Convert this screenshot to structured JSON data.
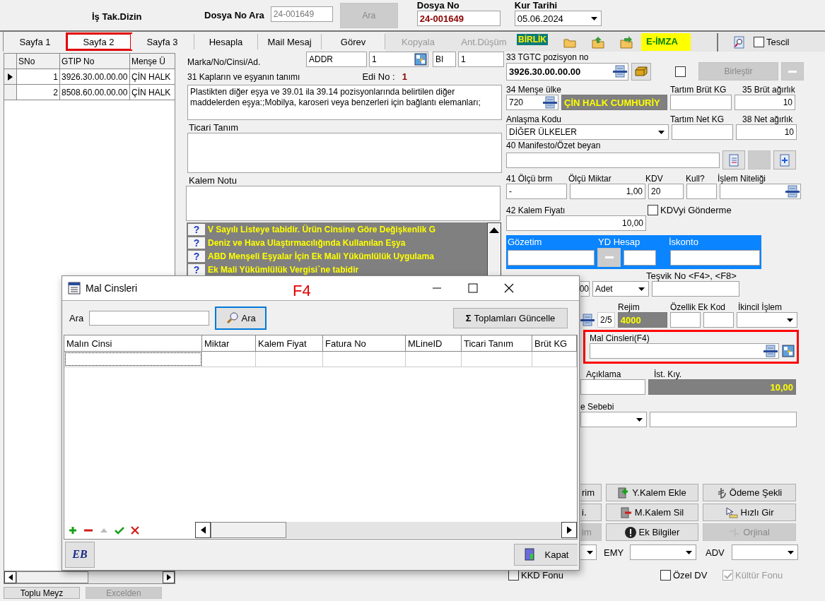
{
  "header": {
    "title": "İş Tak.Dizin",
    "search_label": "Dosya No Ara",
    "search_value": "24-001649",
    "search_button": {
      "label": "Ara",
      "disabled": true
    },
    "file_no_label": "Dosya No",
    "file_no": "24-001649",
    "rate_date_label": "Kur Tarihi",
    "rate_date": "05.06.2024"
  },
  "tabs": [
    {
      "label": "Sayfa 1",
      "selected": false,
      "highlighted": false
    },
    {
      "label": "Sayfa 2",
      "selected": true,
      "highlighted": true
    },
    {
      "label": "Sayfa 3",
      "selected": false,
      "highlighted": false
    },
    {
      "label": "Hesapla",
      "selected": false,
      "highlighted": false
    },
    {
      "label": "Mail Mesaj",
      "selected": false,
      "highlighted": false
    },
    {
      "label": "Görev",
      "selected": false,
      "highlighted": false
    }
  ],
  "toolbar": {
    "actions": [
      {
        "label": "Kopyala",
        "disabled": true
      },
      {
        "label": "Ant.Düşüm",
        "disabled": true
      }
    ],
    "birlik": "BİRLİK",
    "e_imza": "E-İMZA",
    "tescil": {
      "label": "Tescil",
      "checked": false
    }
  },
  "items_grid": {
    "columns": [
      "SNo",
      "GTIP No",
      "Menşe Ü"
    ],
    "rows": [
      {
        "sno": "1",
        "gtip": "3926.30.00.00.00",
        "origin": "ÇİN HALK",
        "selected": true
      },
      {
        "sno": "2",
        "gtip": "8508.60.00.00.00",
        "origin": "ÇİN HALK",
        "selected": false
      }
    ]
  },
  "left_buttons": [
    {
      "label": "Toplu Meyz",
      "disabled": false
    },
    {
      "label": "Excelden",
      "disabled": true
    }
  ],
  "goods": {
    "marka_label": "Marka/No/Cinsi/Ad.",
    "marka_values": [
      "ADDR",
      "1",
      "BI",
      "1"
    ],
    "description_label": "31 Kapların ve eşyanın tanımı",
    "edi_label": "Edi No :",
    "edi_value": "1",
    "description": "Plastikten diğer eşya ve 39.01 ila 39.14 pozisyonlarında belirtilen diğer maddelerden eşya:;Mobilya, karoseri veya benzerleri için bağlantı elemanları;",
    "commercial_label": "Ticari Tanım",
    "note_label": "Kalem Notu",
    "warnings": [
      {
        "icon": "?",
        "text": "V Sayılı Listeye tabidir. Ürün Cinsine Göre Değişkenlik G"
      },
      {
        "icon": "?",
        "text": "Deniz ve Hava Ulaştırmacılığında Kullanılan Eşya"
      },
      {
        "icon": "?",
        "text": "ABD Menşeli Eşyalar İçin Ek Mali Yükümlülük Uygulama"
      },
      {
        "icon": "?",
        "text": "Ek Mali Yükümlülük Vergisi`ne tabidir"
      }
    ]
  },
  "details": {
    "tgtc_label": "33 TGTC pozisyon no",
    "tgtc": "3926.30.00.00.00",
    "tgtc_checked": false,
    "merge_button": {
      "label": "Birleştir",
      "disabled": true
    },
    "origin_label": "34 Menşe ülke",
    "origin_code": "720",
    "origin_name": "ÇİN HALK CUMHURİY",
    "gross_scale_label": "Tartım Brüt KG",
    "gross_label": "35 Brüt ağırlık",
    "gross": "10",
    "agreement_label": "Anlaşma Kodu",
    "agreement": "DİĞER ÜLKELER",
    "net_scale_label": "Tartım Net KG",
    "net_label": "38 Net ağırlık",
    "net": "10",
    "manifest_label": "40 Manifesto/Özet beyan",
    "unit_label": "41 Ölçü brm",
    "unit": "-",
    "qty_label": "Ölçü Miktar",
    "qty": "1,00",
    "vat_label": "KDV",
    "vat": "20",
    "used_label": "Kull?",
    "nature_label": "İşlem Niteliği",
    "price_label": "42 Kalem Fiyatı",
    "price": "10,00",
    "vat_skip": {
      "label": "KDVyi Gönderme",
      "checked": false
    },
    "surveillance_label": "Gözetim",
    "yd_label": "YD Hesap",
    "discount_label": "İskonto",
    "incentive_label": "Teşvik No <F4>, <F8>",
    "amount_partial": "00",
    "unit2": "Adet",
    "page": "2/5",
    "regime_label": "Rejim",
    "regime": "4000",
    "feature_label": "Özellik Ek Kod",
    "secondary_label": "İkincil İşlem",
    "goods_kinds": {
      "label": "Mal Cinsleri(F4)",
      "highlighted": true
    },
    "explanation_label": "Açıklama",
    "stat_label": "İst. Kıy.",
    "stat_value": "10,00",
    "reason_label": "e Sebebi",
    "buttons": [
      {
        "label": "rim",
        "disabled": false
      },
      {
        "label": "Y.Kalem Ekle",
        "disabled": false
      },
      {
        "label": "Ödeme Şekli",
        "disabled": false
      },
      {
        "label": "i.",
        "disabled": false
      },
      {
        "label": "M.Kalem Sil",
        "disabled": false
      },
      {
        "label": "Hızlı Gir",
        "disabled": false
      },
      {
        "label": "im",
        "disabled": true
      },
      {
        "label": "Ek Bilgiler",
        "disabled": false
      },
      {
        "label": "Orjinal",
        "disabled": true
      }
    ],
    "emy_label": "EMY",
    "adv_label": "ADV",
    "checks": [
      {
        "label": "KKD Fonu",
        "checked": false,
        "disabled": false
      },
      {
        "label": "Özel DV",
        "checked": false,
        "disabled": false
      },
      {
        "label": "Kültür Fonu",
        "checked": true,
        "disabled": true
      }
    ]
  },
  "dialog": {
    "title": "Mal Cinsleri",
    "annotation": "F4",
    "search_label": "Ara",
    "search_button": "Ara",
    "update_icon": "Σ",
    "update_button": "Toplamları Güncelle",
    "columns": [
      "Malın Cinsi",
      "Miktar",
      "Kalem Fiyat",
      "Fatura No",
      "MLineID",
      "Ticari Tanım",
      "Brüt KG"
    ],
    "logo_button": "EB",
    "close_button": "Kapat"
  }
}
